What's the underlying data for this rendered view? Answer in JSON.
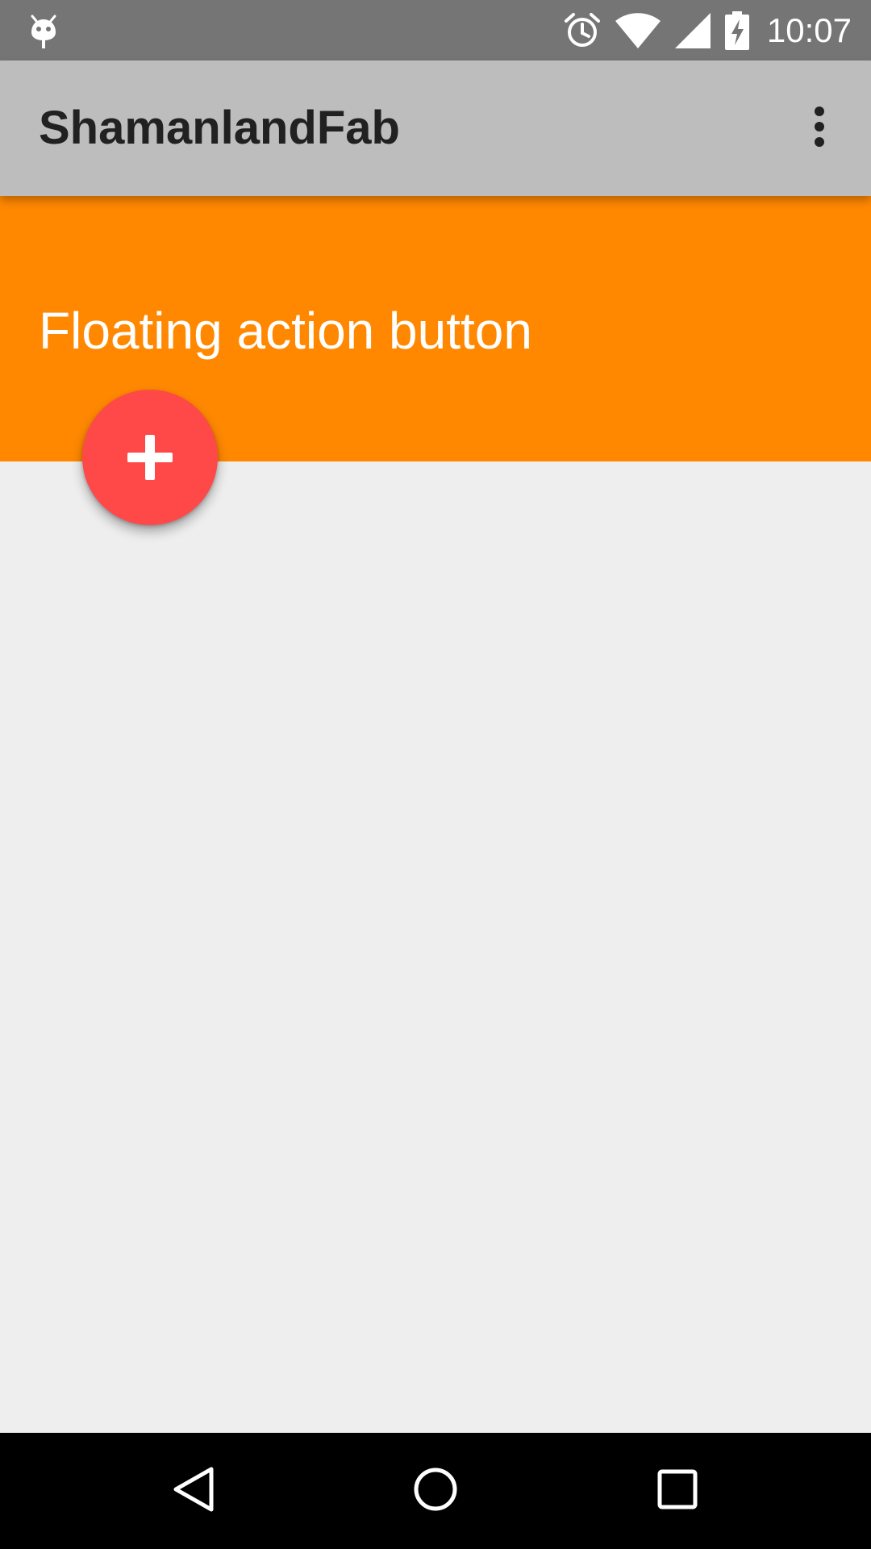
{
  "status_bar": {
    "time": "10:07",
    "left_icon": "android-debug-icon",
    "icons": [
      "alarm-icon",
      "wifi-icon",
      "cellular-signal-icon",
      "battery-charging-icon"
    ],
    "background_color": "#757575"
  },
  "app_bar": {
    "title": "ShamanlandFab",
    "overflow_icon": "more-vert-icon",
    "background_color": "#bdbdbd"
  },
  "header": {
    "title": "Floating action button",
    "background_color": "#ff8800"
  },
  "fab": {
    "icon": "plus-icon",
    "background_color": "#ff4848"
  },
  "content": {
    "background_color": "#eeeeee"
  },
  "nav_bar": {
    "buttons": [
      "back-icon",
      "home-icon",
      "recents-icon"
    ],
    "background_color": "#000000"
  }
}
